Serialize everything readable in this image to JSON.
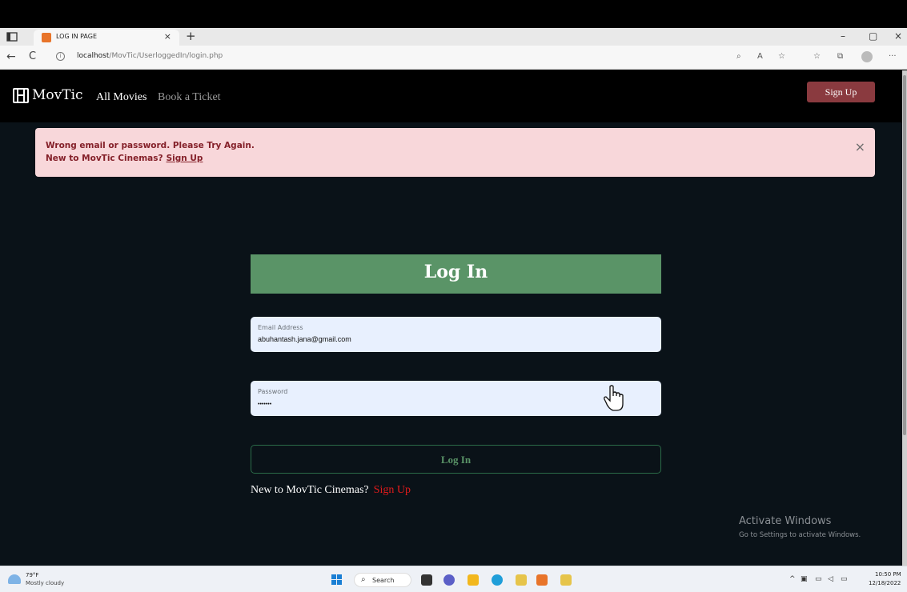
{
  "browser": {
    "tab_title": "LOG IN PAGE",
    "tab_close": "×",
    "new_tab": "+",
    "url_host": "localhost",
    "url_path": "/MovTic/UserloggedIn/login.php",
    "win_minimize": "–",
    "win_restore": "▢",
    "win_close": "×",
    "back": "←",
    "reload": "C",
    "more": "···"
  },
  "navbar": {
    "brand": "MovTic",
    "links": [
      {
        "label": "All Movies"
      },
      {
        "label": "Book a Ticket"
      }
    ],
    "signup_label": "Sign Up"
  },
  "alert": {
    "line1": "Wrong email or password. Please Try Again.",
    "line2_text": "New to MovTic Cinemas?",
    "line2_link": "Sign Up",
    "close": "×"
  },
  "login": {
    "title": "Log In",
    "email_label": "Email Address",
    "email_value": "abuhantash.jana@gmail.com",
    "password_label": "Password",
    "password_value": "•••••••",
    "button_label": "Log In",
    "signup_prompt": "New to MovTic Cinemas?",
    "signup_link": "Sign Up"
  },
  "watermark": {
    "line1": "Activate Windows",
    "line2": "Go to Settings to activate Windows."
  },
  "taskbar": {
    "temperature": "79°F",
    "weather": "Mostly cloudy",
    "search_label": "Search",
    "time": "10:50 PM",
    "date": "12/18/2022"
  },
  "colors": {
    "page_bg": "#0a1218",
    "header_green": "#5a9467",
    "signup_button": "#8a3a3f",
    "alert_bg": "#f8d7da",
    "alert_text": "#842029",
    "link_red": "#e01b1b",
    "field_bg": "#e8f0fe"
  }
}
